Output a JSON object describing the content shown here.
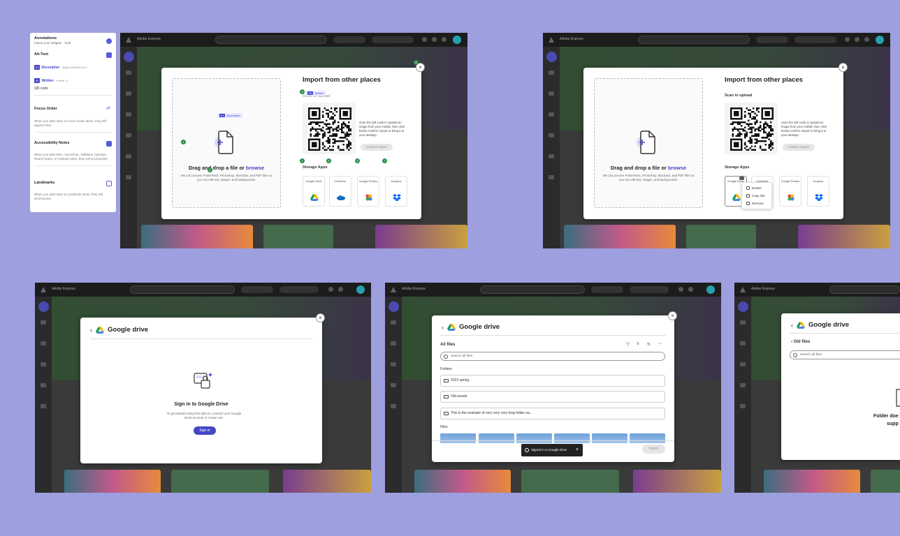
{
  "annotations": {
    "title": "Annotations",
    "subtitle": "Import your widgets · %ab",
    "alt_text": {
      "heading": "Alt-Text",
      "row1_tag": "01",
      "row1_kind": "Decorative",
      "row1_meta": "· Stt&w;AotEBR;Dtt 1",
      "row2_tag": "02",
      "row2_kind": "Written",
      "row2_meta": "· Frame 17",
      "row2_value": "QR code"
    },
    "focus_order": {
      "heading": "Focus Order",
      "text": "When you add notes to Focus Order items, they will appear here."
    },
    "accessibility_notes": {
      "heading": "Accessibility Notes",
      "text": "When you add ARIA, VoiceOver, TalkBack, Narrator, Reach Notes, or Android notes, they will accessories."
    },
    "landmarks": {
      "heading": "Landmarks",
      "text": "When you add notes to Landmark items, they will accessories."
    }
  },
  "app": {
    "title": "Adobe Express",
    "colors": {
      "accent": "#4646c8",
      "marker": "#2f8f4e"
    }
  },
  "import_modal": {
    "title": "Import from other places",
    "scan_label": "Scan to upload",
    "qr_text": "Scan the QR code to Upload an image from your mobile, then click below Confirm import to bring it to your desktop.",
    "confirm_label": "Confirm import",
    "storage_label": "Storage Apps",
    "apps": [
      "Google Drive",
      "OneDrive",
      "Google Photos",
      "Dropbox"
    ],
    "drop_title": "Drag and drop a file or",
    "drop_link": "browse",
    "drop_sub": "We can process PowerPoint, Photoshop, Illustrator, and PDF files so you can edit text, images, and backgrounds.",
    "close": "×",
    "pill_decorative_tag": "01",
    "pill_decorative": "Decorative",
    "pill_written_tag": "02",
    "pill_written": "Written",
    "markers": [
      "1",
      "2",
      "3",
      "4",
      "5",
      "6",
      "7",
      "8",
      "9"
    ]
  },
  "context_menu": {
    "badge": "...",
    "items": [
      "Details",
      "Copy link",
      "Remove"
    ]
  },
  "gdrive_signin": {
    "title": "Google drive",
    "heading": "Sign in to Google Drive",
    "text": "To get started using this add-on, connect your Google Drive account in create one.",
    "button": "Sign in"
  },
  "gdrive_files": {
    "title": "Google drive",
    "all_files": "All files",
    "search_placeholder": "Search all files",
    "folders_label": "Folders",
    "folders": [
      "2023 spring",
      "Old assets",
      "This is the example of very very very long folder na..."
    ],
    "files_label": "Files",
    "toast": "Signed in to Google Drive",
    "import_button": "Import"
  },
  "gdrive_folder": {
    "title": "Google drive",
    "folder": "Old files",
    "search_placeholder": "Search all files",
    "message": "Folder doe",
    "message2": "supp"
  }
}
